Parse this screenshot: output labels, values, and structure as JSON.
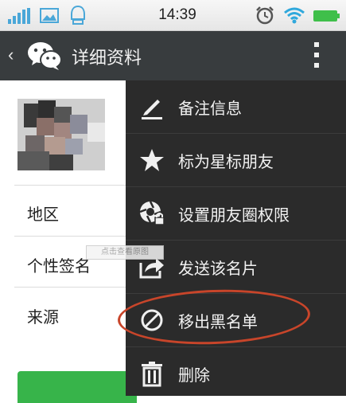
{
  "status_bar": {
    "time": "14:39",
    "icons": [
      "signal-icon",
      "image-icon",
      "notification-icon",
      "alarm-icon",
      "wifi-icon",
      "battery-icon"
    ]
  },
  "title_bar": {
    "back_glyph": "‹",
    "title": "详细资料",
    "more_icon": "more-vertical-icon"
  },
  "profile": {
    "rows": [
      {
        "label": "地区"
      },
      {
        "label": "个性签名"
      },
      {
        "label": "来源"
      }
    ],
    "tooltip": "点击查看原图"
  },
  "menu": {
    "items": [
      {
        "label": "备注信息",
        "icon": "pencil-icon"
      },
      {
        "label": "标为星标朋友",
        "icon": "star-icon"
      },
      {
        "label": "设置朋友圈权限",
        "icon": "camera-lock-icon"
      },
      {
        "label": "发送该名片",
        "icon": "share-icon"
      },
      {
        "label": "移出黑名单",
        "icon": "ban-icon"
      },
      {
        "label": "删除",
        "icon": "trash-icon"
      }
    ]
  },
  "colors": {
    "titlebar": "#383c3e",
    "menu_bg": "#2b2b2b",
    "highlight": "#c8452a",
    "button_green": "#37b44a"
  }
}
